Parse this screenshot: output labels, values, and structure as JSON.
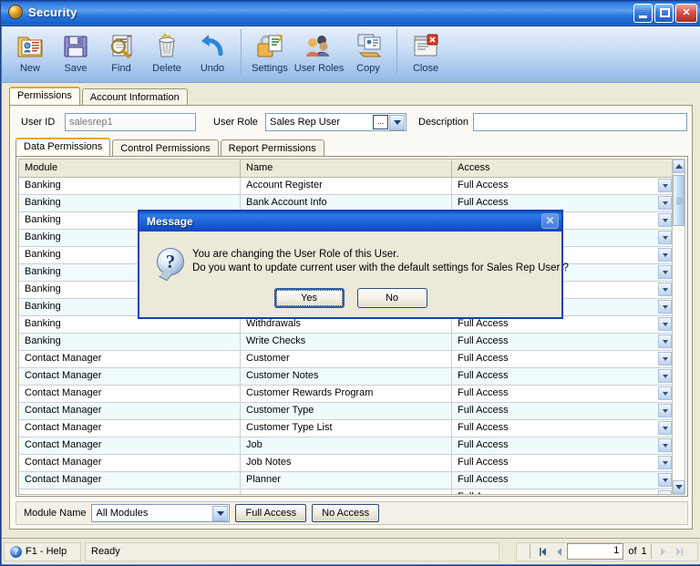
{
  "window": {
    "title": "Security",
    "icon": "orb-icon",
    "buttons": {
      "minimize": "minimize",
      "maximize": "maximize",
      "close": "close"
    }
  },
  "toolbar": {
    "items": [
      {
        "label": "New",
        "icon": "new-record-icon"
      },
      {
        "label": "Save",
        "icon": "floppy-disk-icon"
      },
      {
        "label": "Find",
        "icon": "magnifier-icon"
      },
      {
        "label": "Delete",
        "icon": "trash-can-icon"
      },
      {
        "label": "Undo",
        "icon": "undo-arrow-icon"
      },
      {
        "label": "Settings",
        "icon": "padlock-document-icon"
      },
      {
        "label": "User Roles",
        "icon": "people-group-icon"
      },
      {
        "label": "Copy",
        "icon": "copy-card-icon"
      },
      {
        "label": "Close",
        "icon": "window-close-icon"
      }
    ]
  },
  "outer_tabs": [
    {
      "label": "Permissions",
      "active": true
    },
    {
      "label": "Account Information",
      "active": false
    }
  ],
  "form": {
    "user_id_label": "User ID",
    "user_id_value": "salesrep1",
    "user_role_label": "User Role",
    "user_role_value": "Sales Rep User",
    "ellipsis_button": "...",
    "description_label": "Description",
    "description_value": ""
  },
  "inner_tabs": [
    {
      "label": "Data Permissions",
      "active": true
    },
    {
      "label": "Control Permissions",
      "active": false
    },
    {
      "label": "Report Permissions",
      "active": false
    }
  ],
  "grid": {
    "columns": [
      "Module",
      "Name",
      "Access"
    ],
    "rows": [
      {
        "module": "Banking",
        "name": "Account Register",
        "access": "Full Access"
      },
      {
        "module": "Banking",
        "name": "Bank Account Info",
        "access": "Full Access"
      },
      {
        "module": "Banking",
        "name": "",
        "access": ""
      },
      {
        "module": "Banking",
        "name": "",
        "access": ""
      },
      {
        "module": "Banking",
        "name": "",
        "access": ""
      },
      {
        "module": "Banking",
        "name": "",
        "access": ""
      },
      {
        "module": "Banking",
        "name": "",
        "access": ""
      },
      {
        "module": "Banking",
        "name": "",
        "access": ""
      },
      {
        "module": "Banking",
        "name": "Withdrawals",
        "access": "Full Access"
      },
      {
        "module": "Banking",
        "name": "Write Checks",
        "access": "Full Access"
      },
      {
        "module": "Contact Manager",
        "name": "Customer",
        "access": "Full Access"
      },
      {
        "module": "Contact Manager",
        "name": "Customer Notes",
        "access": "Full Access"
      },
      {
        "module": "Contact Manager",
        "name": "Customer Rewards Program",
        "access": "Full Access"
      },
      {
        "module": "Contact Manager",
        "name": "Customer Type",
        "access": "Full Access"
      },
      {
        "module": "Contact Manager",
        "name": "Customer Type List",
        "access": "Full Access"
      },
      {
        "module": "Contact Manager",
        "name": "Job",
        "access": "Full Access"
      },
      {
        "module": "Contact Manager",
        "name": "Job Notes",
        "access": "Full Access"
      },
      {
        "module": "Contact Manager",
        "name": "Planner",
        "access": "Full Access"
      },
      {
        "module": "",
        "name": "",
        "access": "Full Access"
      }
    ]
  },
  "bottom_bar": {
    "module_name_label": "Module Name",
    "module_name_value": "All Modules",
    "full_access_button": "Full Access",
    "no_access_button": "No Access"
  },
  "status_bar": {
    "help_text": "F1 - Help",
    "status_text": "Ready",
    "page_value": "1",
    "of_label": "of",
    "page_total": "1"
  },
  "dialog": {
    "title": "Message",
    "icon": "question-mark-icon",
    "line1": "You are changing the User Role of this User.",
    "line2": "Do you want to update current user with the default settings for Sales Rep User ?",
    "yes_button": "Yes",
    "no_button": "No",
    "close_button": "✕"
  },
  "colors": {
    "title_blue": "#1b5fc8",
    "accent_orange": "#f0a32a",
    "client_tan": "#ece9d8",
    "row_alt": "#f0fbfd"
  }
}
